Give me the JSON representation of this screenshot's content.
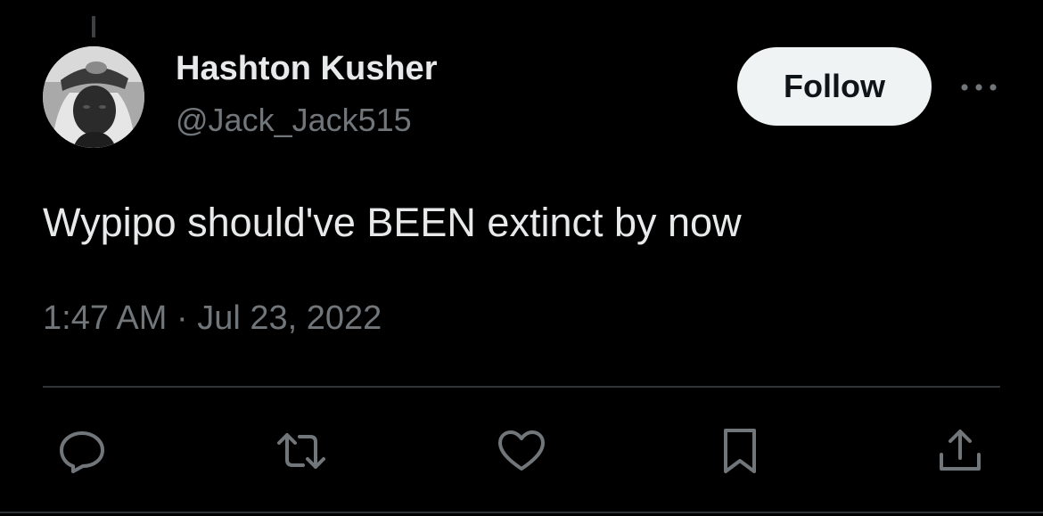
{
  "author": {
    "display_name": "Hashton Kusher",
    "handle": "@Jack_Jack515"
  },
  "follow_button": {
    "label": "Follow"
  },
  "tweet": {
    "text": "Wypipo should've BEEN extinct by now",
    "timestamp": "1:47 AM · Jul 23, 2022"
  },
  "actions": [
    {
      "name": "reply",
      "icon": "reply-icon"
    },
    {
      "name": "retweet",
      "icon": "retweet-icon"
    },
    {
      "name": "like",
      "icon": "heart-icon"
    },
    {
      "name": "bookmark",
      "icon": "bookmark-icon"
    },
    {
      "name": "share",
      "icon": "share-icon"
    }
  ],
  "colors": {
    "background": "#000000",
    "primary_text": "#e7e9ea",
    "secondary_text": "#71767b",
    "divider": "#2f3336",
    "follow_bg": "#eff3f4"
  }
}
